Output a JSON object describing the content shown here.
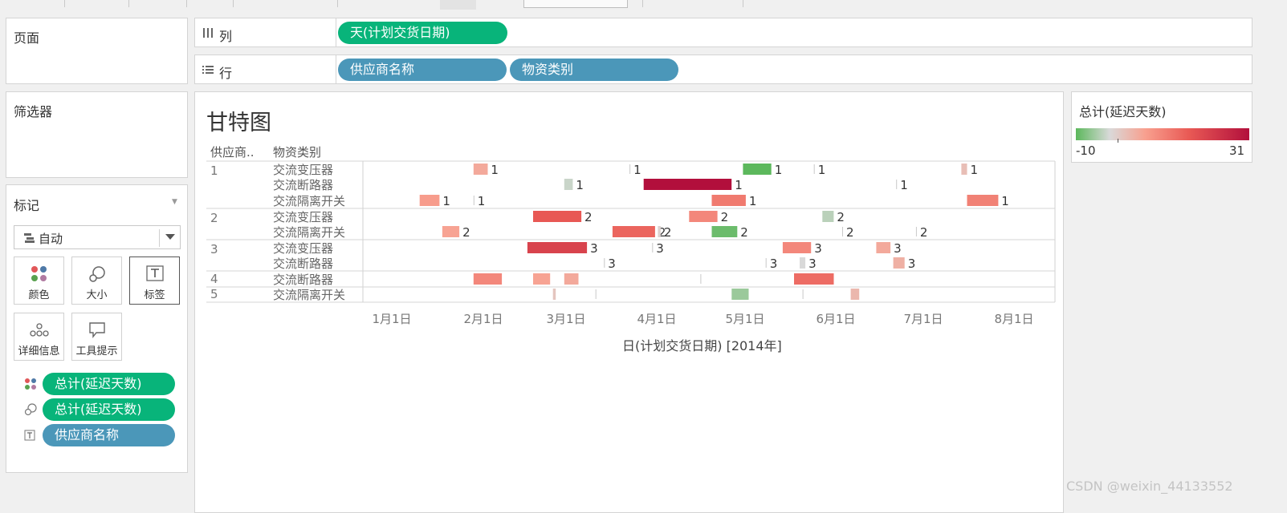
{
  "shelves": {
    "pages_label": "页面",
    "filters_label": "筛选器",
    "columns_label": "列",
    "rows_label": "行",
    "columns_pills": [
      "天(计划交货日期)"
    ],
    "rows_pills": [
      "供应商名称",
      "物资类别"
    ]
  },
  "marks": {
    "title": "标记",
    "mark_type": "自动",
    "buttons": {
      "color": "颜色",
      "size": "大小",
      "label": "标签",
      "detail": "详细信息",
      "tooltip": "工具提示"
    },
    "fields": [
      "总计(延迟天数)",
      "总计(延迟天数)",
      "供应商名称"
    ]
  },
  "sheet": {
    "title": "甘特图",
    "header_supplier": "供应商..",
    "header_category": "物资类别",
    "suppliers": [
      "1",
      "2",
      "3",
      "4",
      "5"
    ],
    "categories": [
      "交流变压器",
      "交流断路器",
      "交流隔离开关",
      "交流变压器",
      "交流隔离开关",
      "交流变压器",
      "交流断路器",
      "交流断路器",
      "交流隔离开关"
    ],
    "x_ticks": [
      "1月1日",
      "2月1日",
      "3月1日",
      "4月1日",
      "5月1日",
      "6月1日",
      "7月1日",
      "8月1日"
    ],
    "x_title": "日(计划交货日期) [2014年]"
  },
  "legend": {
    "title": "总计(延迟天数)",
    "min": "-10",
    "max": "31",
    "colors": {
      "low": "#5cb85c",
      "neutral": "#d9d9d9",
      "mid": "#f8a08f",
      "high": "#b20f3c"
    }
  },
  "chart_data": {
    "type": "gantt",
    "title": "甘特图",
    "xlabel": "日(计划交货日期) [2014年]",
    "x_ticks": [
      "1月1日",
      "2月1日",
      "3月1日",
      "4月1日",
      "5月1日",
      "6月1日",
      "7月1日",
      "8月1日"
    ],
    "x_range": [
      "2013-12-22",
      "2014-08-23"
    ],
    "color_field": "总计(延迟天数)",
    "color_range": [
      -10,
      31
    ],
    "rows": [
      {
        "supplier": "1",
        "category": "交流变压器",
        "tasks": [
          {
            "start": "2014-01-30",
            "delay": 5,
            "label": "1"
          },
          {
            "start": "2014-03-26",
            "delay": 0,
            "label": "1"
          },
          {
            "start": "2014-05-05",
            "delay": -10,
            "label": "1"
          },
          {
            "start": "2014-05-30",
            "delay": 0,
            "label": "1"
          },
          {
            "start": "2014-07-21",
            "delay": 2,
            "label": "1"
          }
        ]
      },
      {
        "supplier": "1",
        "category": "交流断路器",
        "tasks": [
          {
            "start": "2014-03-03",
            "delay": -3,
            "label": "1"
          },
          {
            "start": "2014-03-31",
            "delay": 31,
            "label": "1"
          },
          {
            "start": "2014-06-28",
            "delay": 0,
            "label": "1"
          }
        ]
      },
      {
        "supplier": "1",
        "category": "交流隔离开关",
        "tasks": [
          {
            "start": "2014-01-11",
            "delay": 7,
            "label": "1"
          },
          {
            "start": "2014-01-30",
            "delay": 0,
            "label": "1"
          },
          {
            "start": "2014-04-24",
            "delay": 12,
            "label": "1"
          },
          {
            "start": "2014-07-23",
            "delay": 11,
            "label": "1"
          }
        ]
      },
      {
        "supplier": "2",
        "category": "交流变压器",
        "tasks": [
          {
            "start": "2014-02-20",
            "delay": 17,
            "label": "2"
          },
          {
            "start": "2014-04-16",
            "delay": 10,
            "label": "2"
          },
          {
            "start": "2014-06-02",
            "delay": -4,
            "label": "2"
          }
        ]
      },
      {
        "supplier": "2",
        "category": "交流隔离开关",
        "tasks": [
          {
            "start": "2014-01-19",
            "delay": 6,
            "label": "2"
          },
          {
            "start": "2014-03-20",
            "delay": 15,
            "label": "2"
          },
          {
            "start": "2014-04-05",
            "delay": -1,
            "label": "2"
          },
          {
            "start": "2014-04-24",
            "delay": -9,
            "label": "2"
          },
          {
            "start": "2014-06-09",
            "delay": 0,
            "label": "2"
          },
          {
            "start": "2014-07-05",
            "delay": 0,
            "label": "2"
          }
        ]
      },
      {
        "supplier": "3",
        "category": "交流变压器",
        "tasks": [
          {
            "start": "2014-02-18",
            "delay": 21,
            "label": "3"
          },
          {
            "start": "2014-04-03",
            "delay": 0,
            "label": "3"
          },
          {
            "start": "2014-05-19",
            "delay": 10,
            "label": "3"
          },
          {
            "start": "2014-06-21",
            "delay": 5,
            "label": "3"
          }
        ]
      },
      {
        "supplier": "3",
        "category": "交流断路器",
        "tasks": [
          {
            "start": "2014-03-17",
            "delay": 0,
            "label": "3"
          },
          {
            "start": "2014-05-13",
            "delay": 0,
            "label": "3"
          },
          {
            "start": "2014-05-25",
            "delay": -2,
            "label": "3"
          },
          {
            "start": "2014-06-27",
            "delay": 4,
            "label": "3"
          }
        ]
      },
      {
        "supplier": "4",
        "category": "交流断路器",
        "tasks": [
          {
            "start": "2014-01-30",
            "delay": 10,
            "label": ""
          },
          {
            "start": "2014-02-20",
            "delay": 6,
            "label": ""
          },
          {
            "start": "2014-03-03",
            "delay": 5,
            "label": ""
          },
          {
            "start": "2014-04-20",
            "delay": 0,
            "label": ""
          },
          {
            "start": "2014-05-23",
            "delay": 14,
            "label": ""
          }
        ]
      },
      {
        "supplier": "5",
        "category": "交流隔离开关",
        "tasks": [
          {
            "start": "2014-02-27",
            "delay": 1,
            "label": ""
          },
          {
            "start": "2014-03-14",
            "delay": 0,
            "label": ""
          },
          {
            "start": "2014-05-01",
            "delay": -6,
            "label": ""
          },
          {
            "start": "2014-05-26",
            "delay": 0,
            "label": ""
          },
          {
            "start": "2014-06-12",
            "delay": 3,
            "label": ""
          }
        ]
      }
    ]
  },
  "watermark": "CSDN @weixin_44133552"
}
